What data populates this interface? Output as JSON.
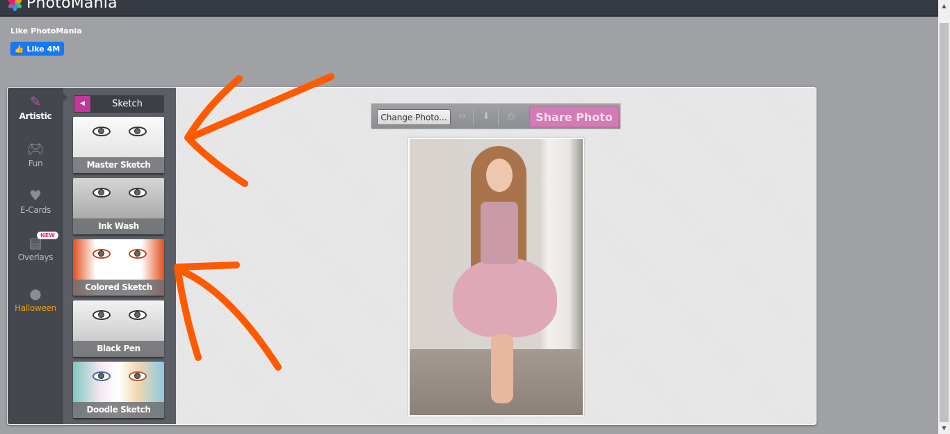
{
  "header": {
    "app_name": "PhotoMania",
    "logo_icon": "pinwheel-logo-icon"
  },
  "facebook": {
    "title": "Like PhotoMania",
    "like_label": "Like 4M",
    "like_icon": "thumbs-up-icon"
  },
  "categories": [
    {
      "id": "artistic",
      "label": "Artistic",
      "icon": "magic-wand-icon",
      "active": true
    },
    {
      "id": "fun",
      "label": "Fun",
      "icon": "gamepad-icon",
      "active": false
    },
    {
      "id": "ecards",
      "label": "E-Cards",
      "icon": "heart-icon",
      "active": false
    },
    {
      "id": "overlays",
      "label": "Overlays",
      "icon": "bricks-icon",
      "badge": "NEW",
      "active": false
    },
    {
      "id": "halloween",
      "label": "Halloween",
      "icon": "pumpkin-icon",
      "active": false
    }
  ],
  "effects_panel": {
    "title": "Sketch",
    "back_icon": "caret-left-icon",
    "items": [
      {
        "label": "Master Sketch"
      },
      {
        "label": "Ink Wash"
      },
      {
        "label": "Colored Sketch"
      },
      {
        "label": "Black Pen"
      },
      {
        "label": "Doodle Sketch"
      }
    ]
  },
  "toolbar": {
    "change_photo": "Change Photo...",
    "embed_icon": "code-icon",
    "download_icon": "download-icon",
    "print_icon": "print-icon",
    "share": "Share Photo"
  },
  "photo": {
    "description": "Girl in pink tutu dress walking barefoot"
  },
  "annotations": {
    "color": "#ff5a00",
    "count": 2
  },
  "colors": {
    "accent": "#c0389a",
    "share": "#d37bb3",
    "facebook": "#1877f2",
    "halloween": "#e0a020"
  }
}
